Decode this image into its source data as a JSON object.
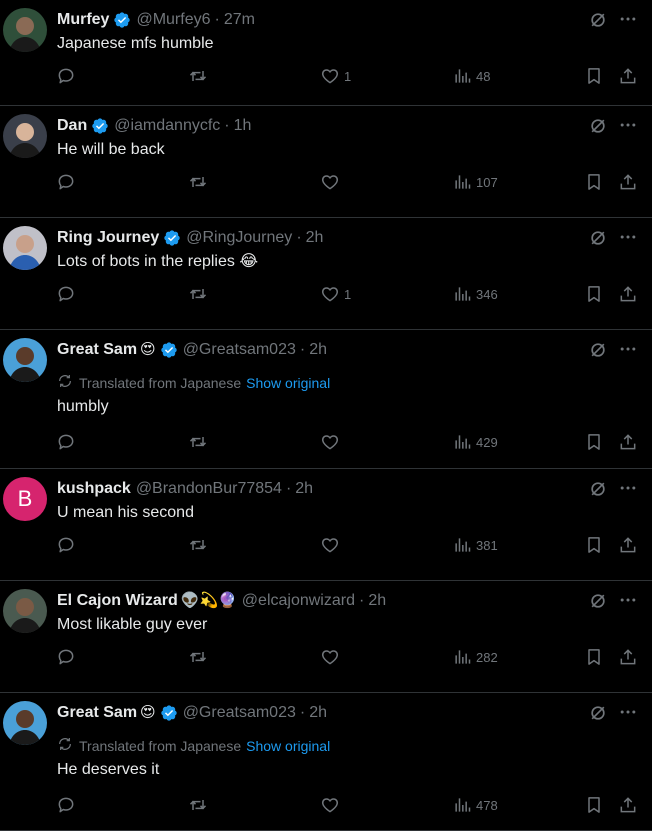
{
  "colors": {
    "background": "#000000",
    "text": "#e7e9ea",
    "secondary": "#71767b",
    "link": "#1d9bf0",
    "verified": "#1d9bf0",
    "divider": "#2f3336"
  },
  "icons": [
    "verified-badge-icon",
    "grok-icon",
    "more-icon",
    "reply-icon",
    "repost-icon",
    "like-icon",
    "views-icon",
    "bookmark-icon",
    "share-icon",
    "translate-icon"
  ],
  "replies": [
    {
      "name": "Murfey",
      "emoji": "",
      "handle": "@Murfey6",
      "time": "27m",
      "translated": false,
      "text": "Japanese mfs humble",
      "likes": "1",
      "views": "48",
      "avatar": "photo"
    },
    {
      "name": "Dan",
      "emoji": "",
      "handle": "@iamdannycfc",
      "time": "1h",
      "translated": false,
      "text": "He will be back",
      "likes": "",
      "views": "107",
      "avatar": "photo"
    },
    {
      "name": "Ring Journey",
      "emoji": "",
      "handle": "@RingJourney",
      "time": "2h",
      "translated": false,
      "text": "Lots of bots in the replies 😂",
      "likes": "1",
      "views": "346",
      "avatar": "photo"
    },
    {
      "name": "Great Sam",
      "emoji": "😍",
      "handle": "@Greatsam023",
      "time": "2h",
      "translated": true,
      "text": "humbly",
      "likes": "",
      "views": "429",
      "avatar": "photo"
    },
    {
      "name": "kushpack",
      "emoji": "",
      "handle": "@BrandonBur77854",
      "time": "2h",
      "translated": false,
      "text": "U mean his second",
      "likes": "",
      "views": "381",
      "avatar": "letter",
      "avatar_letter": "B",
      "avatar_color": "#d6246e"
    },
    {
      "name": "El Cajon Wizard",
      "emoji": "👽💫🔮",
      "handle": "@elcajonwizard",
      "time": "2h",
      "translated": false,
      "text": "Most likable guy ever",
      "likes": "",
      "views": "282",
      "avatar": "photo"
    },
    {
      "name": "Great Sam",
      "emoji": "😍",
      "handle": "@Greatsam023",
      "time": "2h",
      "translated": true,
      "text": "He deserves it",
      "likes": "",
      "views": "478",
      "avatar": "photo"
    }
  ],
  "translation": {
    "label": "Translated from Japanese",
    "show_original": "Show original"
  }
}
